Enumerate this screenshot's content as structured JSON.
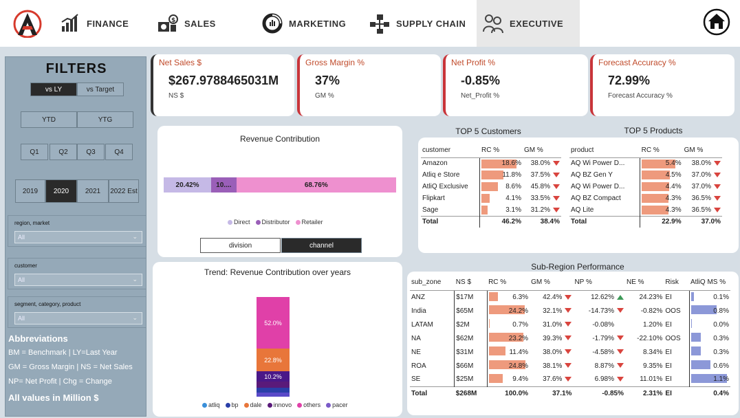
{
  "nav": {
    "items": [
      {
        "label": "FINANCE",
        "icon": "finance-chart-icon"
      },
      {
        "label": "SALES",
        "icon": "sales-money-icon"
      },
      {
        "label": "MARKETING",
        "icon": "marketing-donut-icon"
      },
      {
        "label": "SUPPLY CHAIN",
        "icon": "supply-chain-icon"
      },
      {
        "label": "EXECUTIVE",
        "icon": "executive-people-icon"
      }
    ],
    "active": "EXECUTIVE"
  },
  "filters": {
    "title": "FILTERS",
    "compare": [
      "vs LY",
      "vs Target"
    ],
    "period": [
      "YTD",
      "YTG"
    ],
    "quarters": [
      "Q1",
      "Q2",
      "Q3",
      "Q4"
    ],
    "years": [
      "2019",
      "2020",
      "2021",
      "2022 Est"
    ],
    "selected_compare": "vs LY",
    "selected_year": "2020",
    "slicers": [
      {
        "label": "region, market",
        "value": "All"
      },
      {
        "label": "customer",
        "value": "All"
      },
      {
        "label": "segment, category, product",
        "value": "All"
      }
    ]
  },
  "abbreviations": {
    "title": "Abbreviations",
    "lines": [
      "BM = Benchmark | LY=Last Year",
      "GM = Gross Margin | NS = Net Sales",
      "NP= Net Profit | Chg = Change"
    ],
    "note": "All values in Million $"
  },
  "kpis": [
    {
      "title": "Net Sales $",
      "value": "$267.9788465031M",
      "sub": "NS $"
    },
    {
      "title": "Gross Margin %",
      "value": "37%",
      "sub": "GM %"
    },
    {
      "title": "Net Profit %",
      "value": "-0.85%",
      "sub": "Net_Profit %"
    },
    {
      "title": "Forecast Accuracy %",
      "value": "72.99%",
      "sub": "Forecast Accuracy %"
    }
  ],
  "revenue_contribution": {
    "title": "Revenue Contribution",
    "toggle": [
      "division",
      "channel"
    ],
    "selected_toggle": "channel",
    "legend": [
      {
        "name": "Direct",
        "color": "#c5b9e6"
      },
      {
        "name": "Distributor",
        "color": "#9a5fb8"
      },
      {
        "name": "Retailer",
        "color": "#ee90cf"
      }
    ],
    "segments": [
      {
        "label": "20.42%",
        "value": 20.42,
        "color": "#c5b9e6"
      },
      {
        "label": "10....",
        "value": 10.82,
        "color": "#9a5fb8"
      },
      {
        "label": "68.76%",
        "value": 68.76,
        "color": "#ee90cf"
      }
    ]
  },
  "trend": {
    "title": "Trend: Revenue Contribution over years",
    "legend": [
      {
        "name": "atliq",
        "color": "#3a8fd9"
      },
      {
        "name": "bp",
        "color": "#2a3fa8"
      },
      {
        "name": "dale",
        "color": "#e8763a"
      },
      {
        "name": "innovo",
        "color": "#5a1a7a"
      },
      {
        "name": "others",
        "color": "#e040a8"
      },
      {
        "name": "pacer",
        "color": "#7a5ac8"
      }
    ],
    "stack": [
      {
        "name": "pacer",
        "value": 4,
        "label": "",
        "color": "#5a4ac8"
      },
      {
        "name": "bp",
        "value": 5,
        "label": "",
        "color": "#2a3fa8"
      },
      {
        "name": "innovo",
        "value": 6,
        "label": "",
        "color": "#5a1a7a"
      },
      {
        "name": "innovo2",
        "value": 10.2,
        "label": "10.2%",
        "color": "#4a1888"
      },
      {
        "name": "dale",
        "value": 22.8,
        "label": "22.8%",
        "color": "#e8763a"
      },
      {
        "name": "others",
        "value": 52.0,
        "label": "52.0%",
        "color": "#e040a8"
      }
    ]
  },
  "top_customers": {
    "title": "TOP 5 Customers",
    "headers": [
      "customer",
      "RC %",
      "GM %"
    ],
    "rows": [
      {
        "name": "Amazon",
        "rc": "18.6%",
        "rcv": 18.6,
        "gm": "38.0%"
      },
      {
        "name": "Atliq e Store",
        "rc": "11.8%",
        "rcv": 11.8,
        "gm": "37.5%"
      },
      {
        "name": "AtliQ Exclusive",
        "rc": "8.6%",
        "rcv": 8.6,
        "gm": "45.8%"
      },
      {
        "name": "Flipkart",
        "rc": "4.1%",
        "rcv": 4.1,
        "gm": "33.5%"
      },
      {
        "name": "Sage",
        "rc": "3.1%",
        "rcv": 3.1,
        "gm": "31.2%"
      }
    ],
    "total": {
      "name": "Total",
      "rc": "46.2%",
      "gm": "38.4%"
    }
  },
  "top_products": {
    "title": "TOP 5 Products",
    "headers": [
      "product",
      "RC %",
      "GM %"
    ],
    "rows": [
      {
        "name": "AQ Wi Power D...",
        "rc": "5.4%",
        "rcv": 5.4,
        "gm": "38.0%"
      },
      {
        "name": "AQ BZ Gen Y",
        "rc": "4.5%",
        "rcv": 4.5,
        "gm": "37.0%"
      },
      {
        "name": "AQ Wi Power D...",
        "rc": "4.4%",
        "rcv": 4.4,
        "gm": "37.0%"
      },
      {
        "name": "AQ BZ Compact",
        "rc": "4.3%",
        "rcv": 4.3,
        "gm": "36.5%"
      },
      {
        "name": "AQ Lite",
        "rc": "4.3%",
        "rcv": 4.3,
        "gm": "36.5%"
      }
    ],
    "total": {
      "name": "Total",
      "rc": "22.9%",
      "gm": "37.0%"
    }
  },
  "subregion": {
    "title": "Sub-Region Performance",
    "headers": [
      "sub_zone",
      "NS $",
      "RC %",
      "GM %",
      "NP %",
      "NE %",
      "Risk",
      "AtliQ MS %"
    ],
    "rows": [
      {
        "zone": "ANZ",
        "ns": "$17M",
        "rc": "6.3%",
        "rcv": 6.3,
        "gm": "42.4%",
        "gm_tri": "down",
        "np": "12.62%",
        "np_tri": "up",
        "ne": "24.23%",
        "risk": "EI",
        "ms": "0.1%",
        "msv": 0.1
      },
      {
        "zone": "India",
        "ns": "$65M",
        "rc": "24.2%",
        "rcv": 24.2,
        "gm": "32.1%",
        "gm_tri": "down",
        "np": "-14.73%",
        "np_tri": "down",
        "ne": "-0.82%",
        "risk": "OOS",
        "ms": "0.8%",
        "msv": 0.8
      },
      {
        "zone": "LATAM",
        "ns": "$2M",
        "rc": "0.7%",
        "rcv": 0.7,
        "gm": "31.0%",
        "gm_tri": "down",
        "np": "-0.08%",
        "np_tri": "",
        "ne": "1.20%",
        "risk": "EI",
        "ms": "0.0%",
        "msv": 0.0
      },
      {
        "zone": "NA",
        "ns": "$62M",
        "rc": "23.2%",
        "rcv": 23.2,
        "gm": "39.3%",
        "gm_tri": "down",
        "np": "-1.79%",
        "np_tri": "down",
        "ne": "-22.10%",
        "risk": "OOS",
        "ms": "0.3%",
        "msv": 0.3
      },
      {
        "zone": "NE",
        "ns": "$31M",
        "rc": "11.4%",
        "rcv": 11.4,
        "gm": "38.0%",
        "gm_tri": "down",
        "np": "-4.58%",
        "np_tri": "down",
        "ne": "8.34%",
        "risk": "EI",
        "ms": "0.3%",
        "msv": 0.3
      },
      {
        "zone": "ROA",
        "ns": "$66M",
        "rc": "24.8%",
        "rcv": 24.8,
        "gm": "38.1%",
        "gm_tri": "down",
        "np": "8.87%",
        "np_tri": "down",
        "ne": "9.35%",
        "risk": "EI",
        "ms": "0.6%",
        "msv": 0.6
      },
      {
        "zone": "SE",
        "ns": "$25M",
        "rc": "9.4%",
        "rcv": 9.4,
        "gm": "37.6%",
        "gm_tri": "down",
        "np": "6.98%",
        "np_tri": "down",
        "ne": "11.01%",
        "risk": "EI",
        "ms": "1.1%",
        "msv": 1.1
      }
    ],
    "total": {
      "zone": "Total",
      "ns": "$268M",
      "rc": "100.0%",
      "gm": "37.1%",
      "np": "-0.85%",
      "ne": "2.31%",
      "risk": "EI",
      "ms": "0.4%"
    }
  }
}
